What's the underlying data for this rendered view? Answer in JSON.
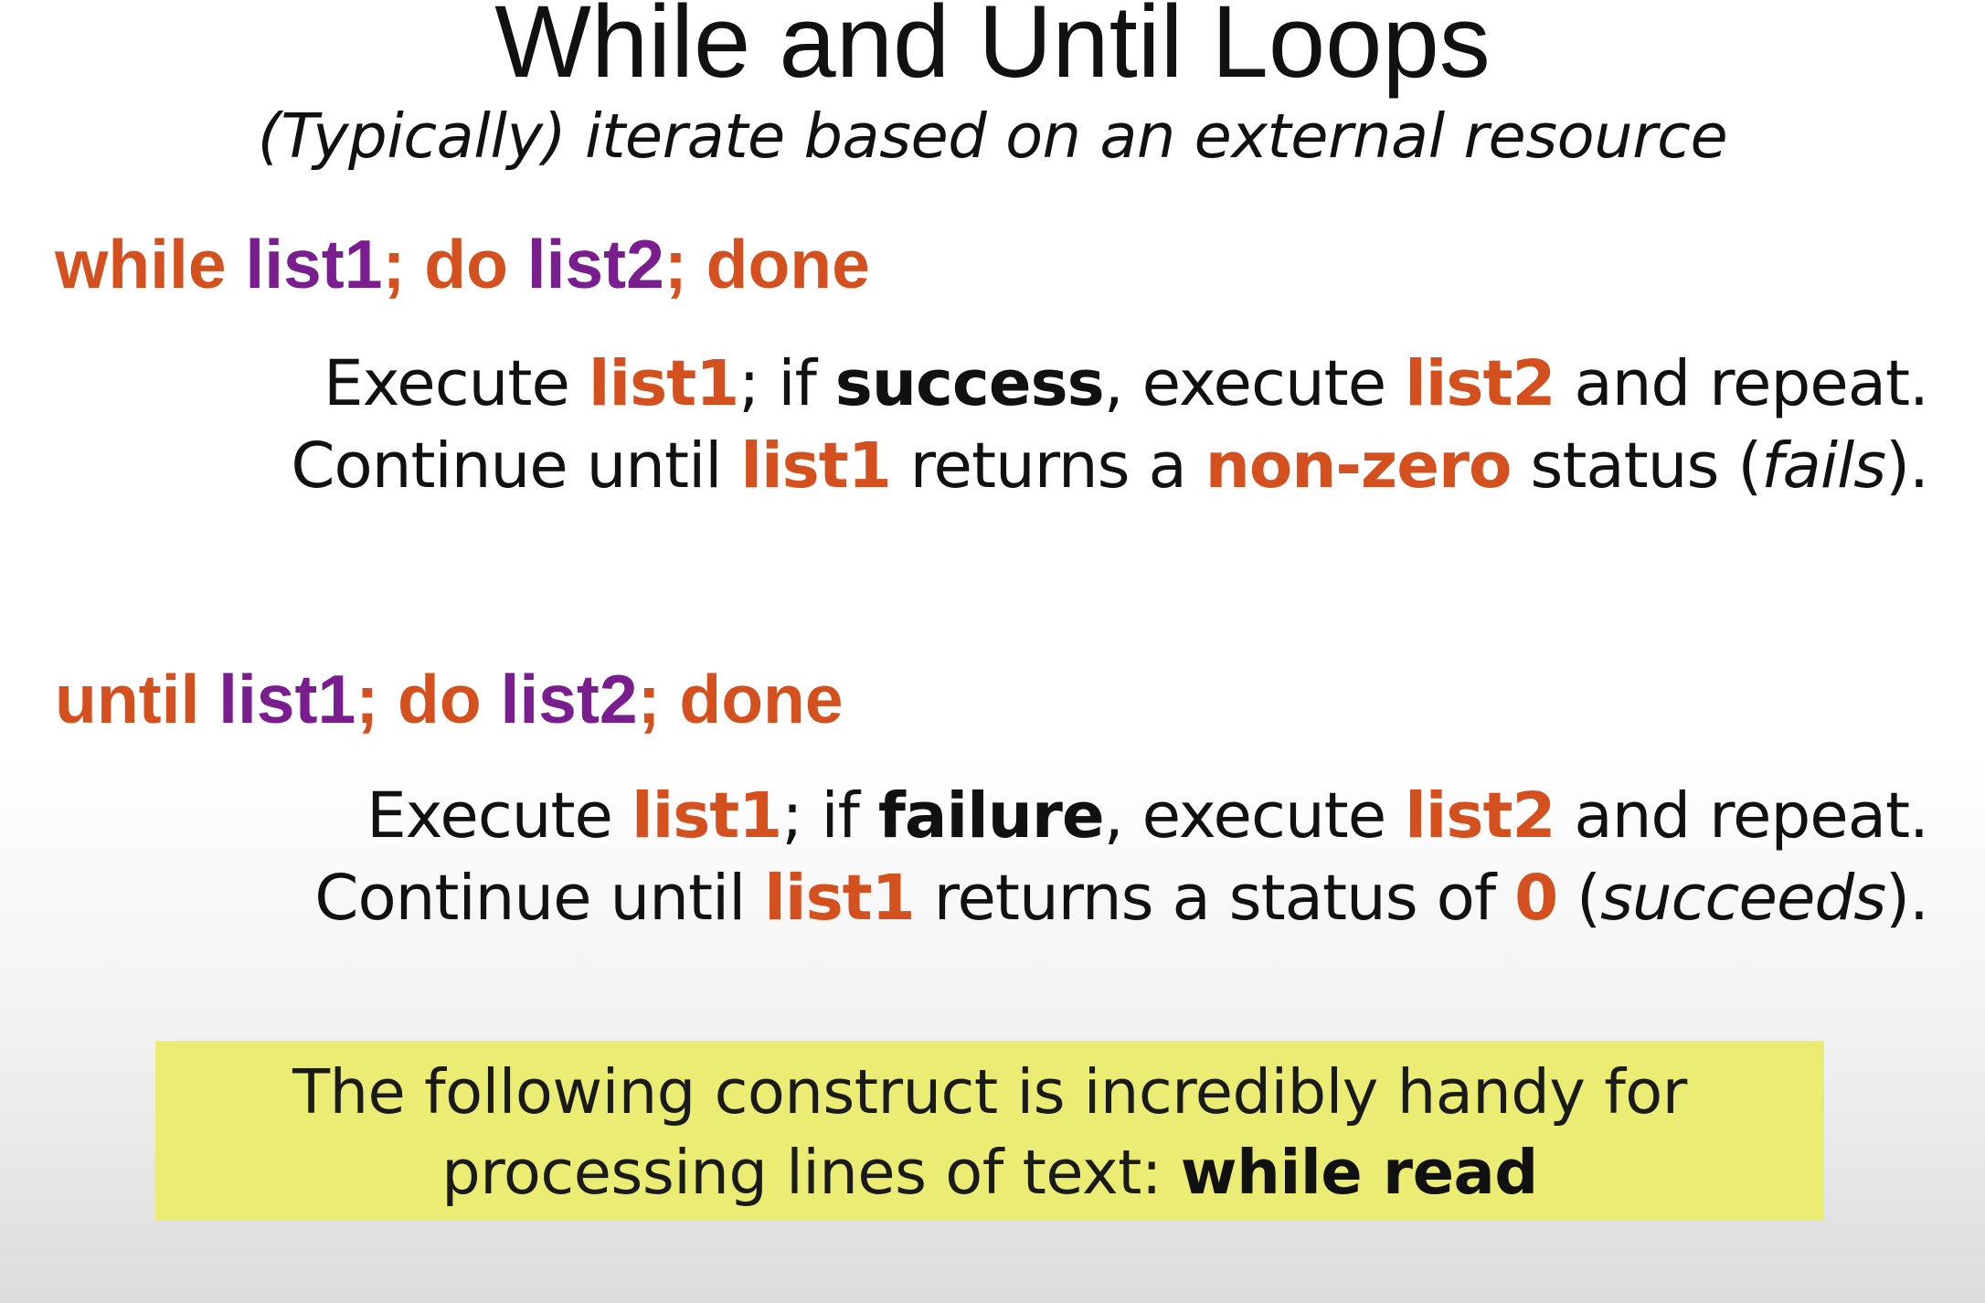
{
  "slide": {
    "title": "While and Until Loops",
    "subtitle": "(Typically) iterate based on an external resource"
  },
  "while_block": {
    "syntax": {
      "kw1": "while ",
      "list1": "list1",
      "kw2": "; do ",
      "list2": "list2",
      "kw3": "; done"
    },
    "line1": {
      "t1": "Execute ",
      "list1": "list1",
      "t2": "; if ",
      "cond": "success",
      "t3": ", execute ",
      "list2": "list2",
      "t4": " and repeat."
    },
    "line2": {
      "t1": "Continue until ",
      "list1": "list1",
      "t2": " returns  a ",
      "status": "non-zero",
      "t3": " status (",
      "result": "fails",
      "t4": ")."
    }
  },
  "until_block": {
    "syntax": {
      "kw1": "until ",
      "list1": "list1",
      "kw2": "; do ",
      "list2": "list2",
      "kw3": "; done"
    },
    "line1": {
      "t1": "Execute ",
      "list1": "list1",
      "t2": "; if ",
      "cond": "failure",
      "t3": ", execute ",
      "list2": "list2",
      "t4": " and repeat."
    },
    "line2": {
      "t1": "Continue until ",
      "list1": "list1",
      "t2": " returns a status of ",
      "status": "0",
      "t3": " (",
      "result": "succeeds",
      "t4": ")."
    }
  },
  "note": {
    "line1": "The following construct is incredibly handy for",
    "line2_text": "processing lines of text: ",
    "line2_cmd": "while read"
  },
  "colors": {
    "keyword": "#d4501e",
    "variable": "#7a1d8e",
    "highlight_box": "#eaec74",
    "text": "#111111"
  }
}
